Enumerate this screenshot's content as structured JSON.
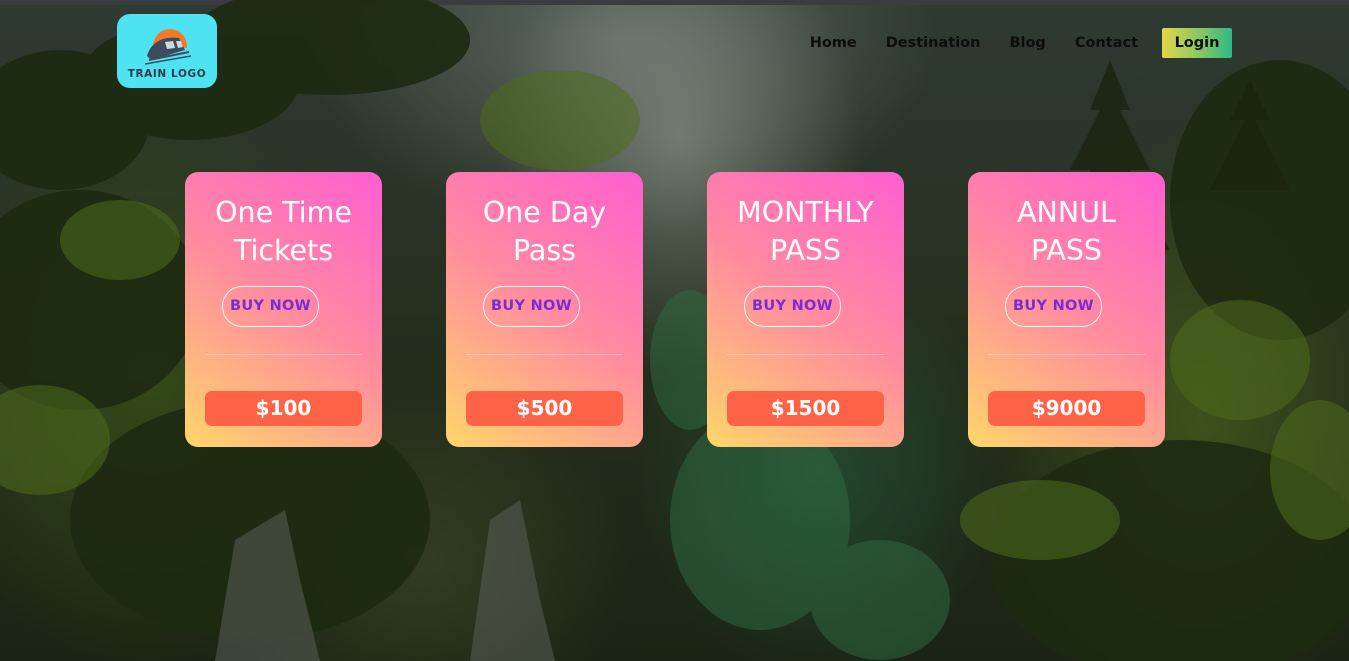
{
  "brand": {
    "logo_text": "TRAIN LOGO",
    "logo_color": "#4ee3f2"
  },
  "nav": {
    "items": [
      {
        "label": "Home"
      },
      {
        "label": "Destination"
      },
      {
        "label": "Blog"
      },
      {
        "label": "Contact"
      }
    ],
    "login_label": "Login"
  },
  "cards": [
    {
      "title_line1": "One Time",
      "title_line2": "Tickets",
      "button_label": "BUY NOW",
      "price": "$100"
    },
    {
      "title_line1": "One Day",
      "title_line2": "Pass",
      "button_label": "BUY NOW",
      "price": "$500"
    },
    {
      "title_line1": "MONTHLY",
      "title_line2": "PASS",
      "button_label": "BUY NOW",
      "price": "$1500"
    },
    {
      "title_line1": "ANNUL",
      "title_line2": "PASS",
      "button_label": "BUY NOW",
      "price": "$9000"
    }
  ],
  "colors": {
    "card_gradient_top": "#ff5ed1",
    "card_gradient_bottom": "#ffd66a",
    "price_badge": "#ff6347",
    "buy_text": "#7a2bd6"
  }
}
